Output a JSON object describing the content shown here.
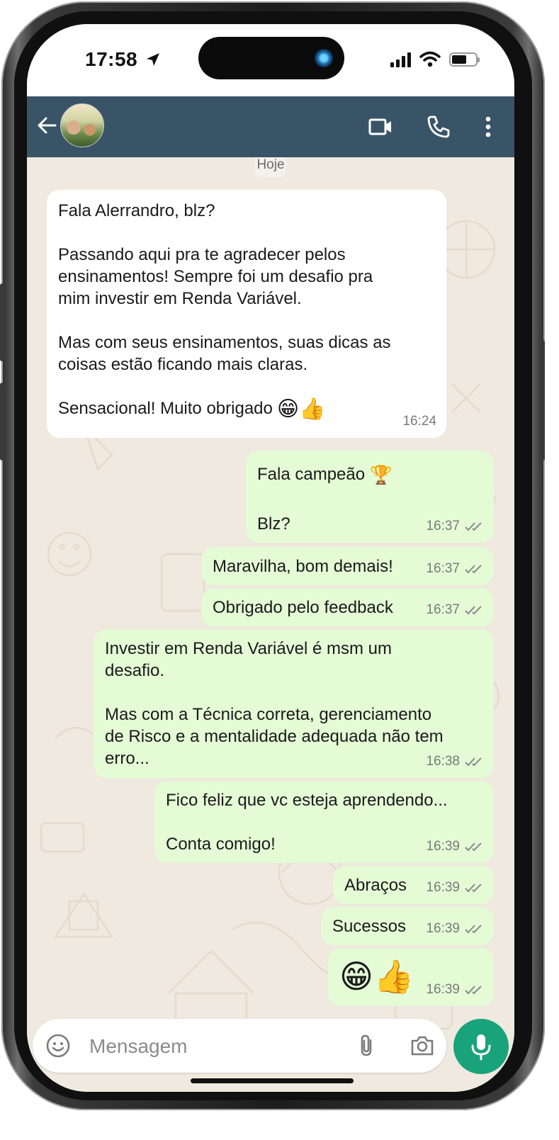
{
  "status_bar": {
    "time": "17:58"
  },
  "header": {
    "contact_avatar": "avatar"
  },
  "chat": {
    "date_label": "Hoje",
    "messages": [
      {
        "dir": "in",
        "text": "Fala Alerrandro, blz?\n\nPassando aqui pra te agradecer pelos\nensinamentos! Sempre foi um desafio pra\nmim investir em Renda Variável.\n\nMas com seus ensinamentos, suas dicas as\ncoisas estão ficando mais claras.\n\nSensacional! Muito obrigado",
        "emoji": "😁👍",
        "time": "16:24"
      },
      {
        "dir": "out",
        "text": "Fala campeão",
        "emoji": "🏆",
        "text2": "Blz?",
        "time": "16:37"
      },
      {
        "dir": "out",
        "text": "Maravilha, bom demais!",
        "time": "16:37"
      },
      {
        "dir": "out",
        "text": "Obrigado pelo feedback",
        "time": "16:37"
      },
      {
        "dir": "out",
        "text": "Investir em Renda Variável é msm um\ndesafio.\n\nMas com a Técnica correta, gerenciamento\nde Risco e a mentalidade adequada não tem\nerro...",
        "time": "16:38"
      },
      {
        "dir": "out",
        "text": "Fico feliz que vc esteja aprendendo...\n\nConta comigo!",
        "time": "16:39"
      },
      {
        "dir": "out",
        "text": "Abraços",
        "time": "16:39"
      },
      {
        "dir": "out",
        "text": "Sucessos",
        "time": "16:39"
      },
      {
        "dir": "out",
        "text": "",
        "emoji": "😁👍",
        "time": "16:39"
      }
    ]
  },
  "input": {
    "placeholder": "Mensagem"
  },
  "colors": {
    "header": "#3a5467",
    "outgoing": "#e4fbd6",
    "incoming": "#ffffff",
    "mic": "#18a37a",
    "wallpaper": "#efe9df"
  },
  "icons": [
    "back-arrow-icon",
    "video-call-icon",
    "phone-call-icon",
    "more-options-icon",
    "emoji-icon",
    "attach-icon",
    "camera-icon",
    "mic-icon",
    "read-ticks-icon",
    "location-arrow-icon"
  ]
}
